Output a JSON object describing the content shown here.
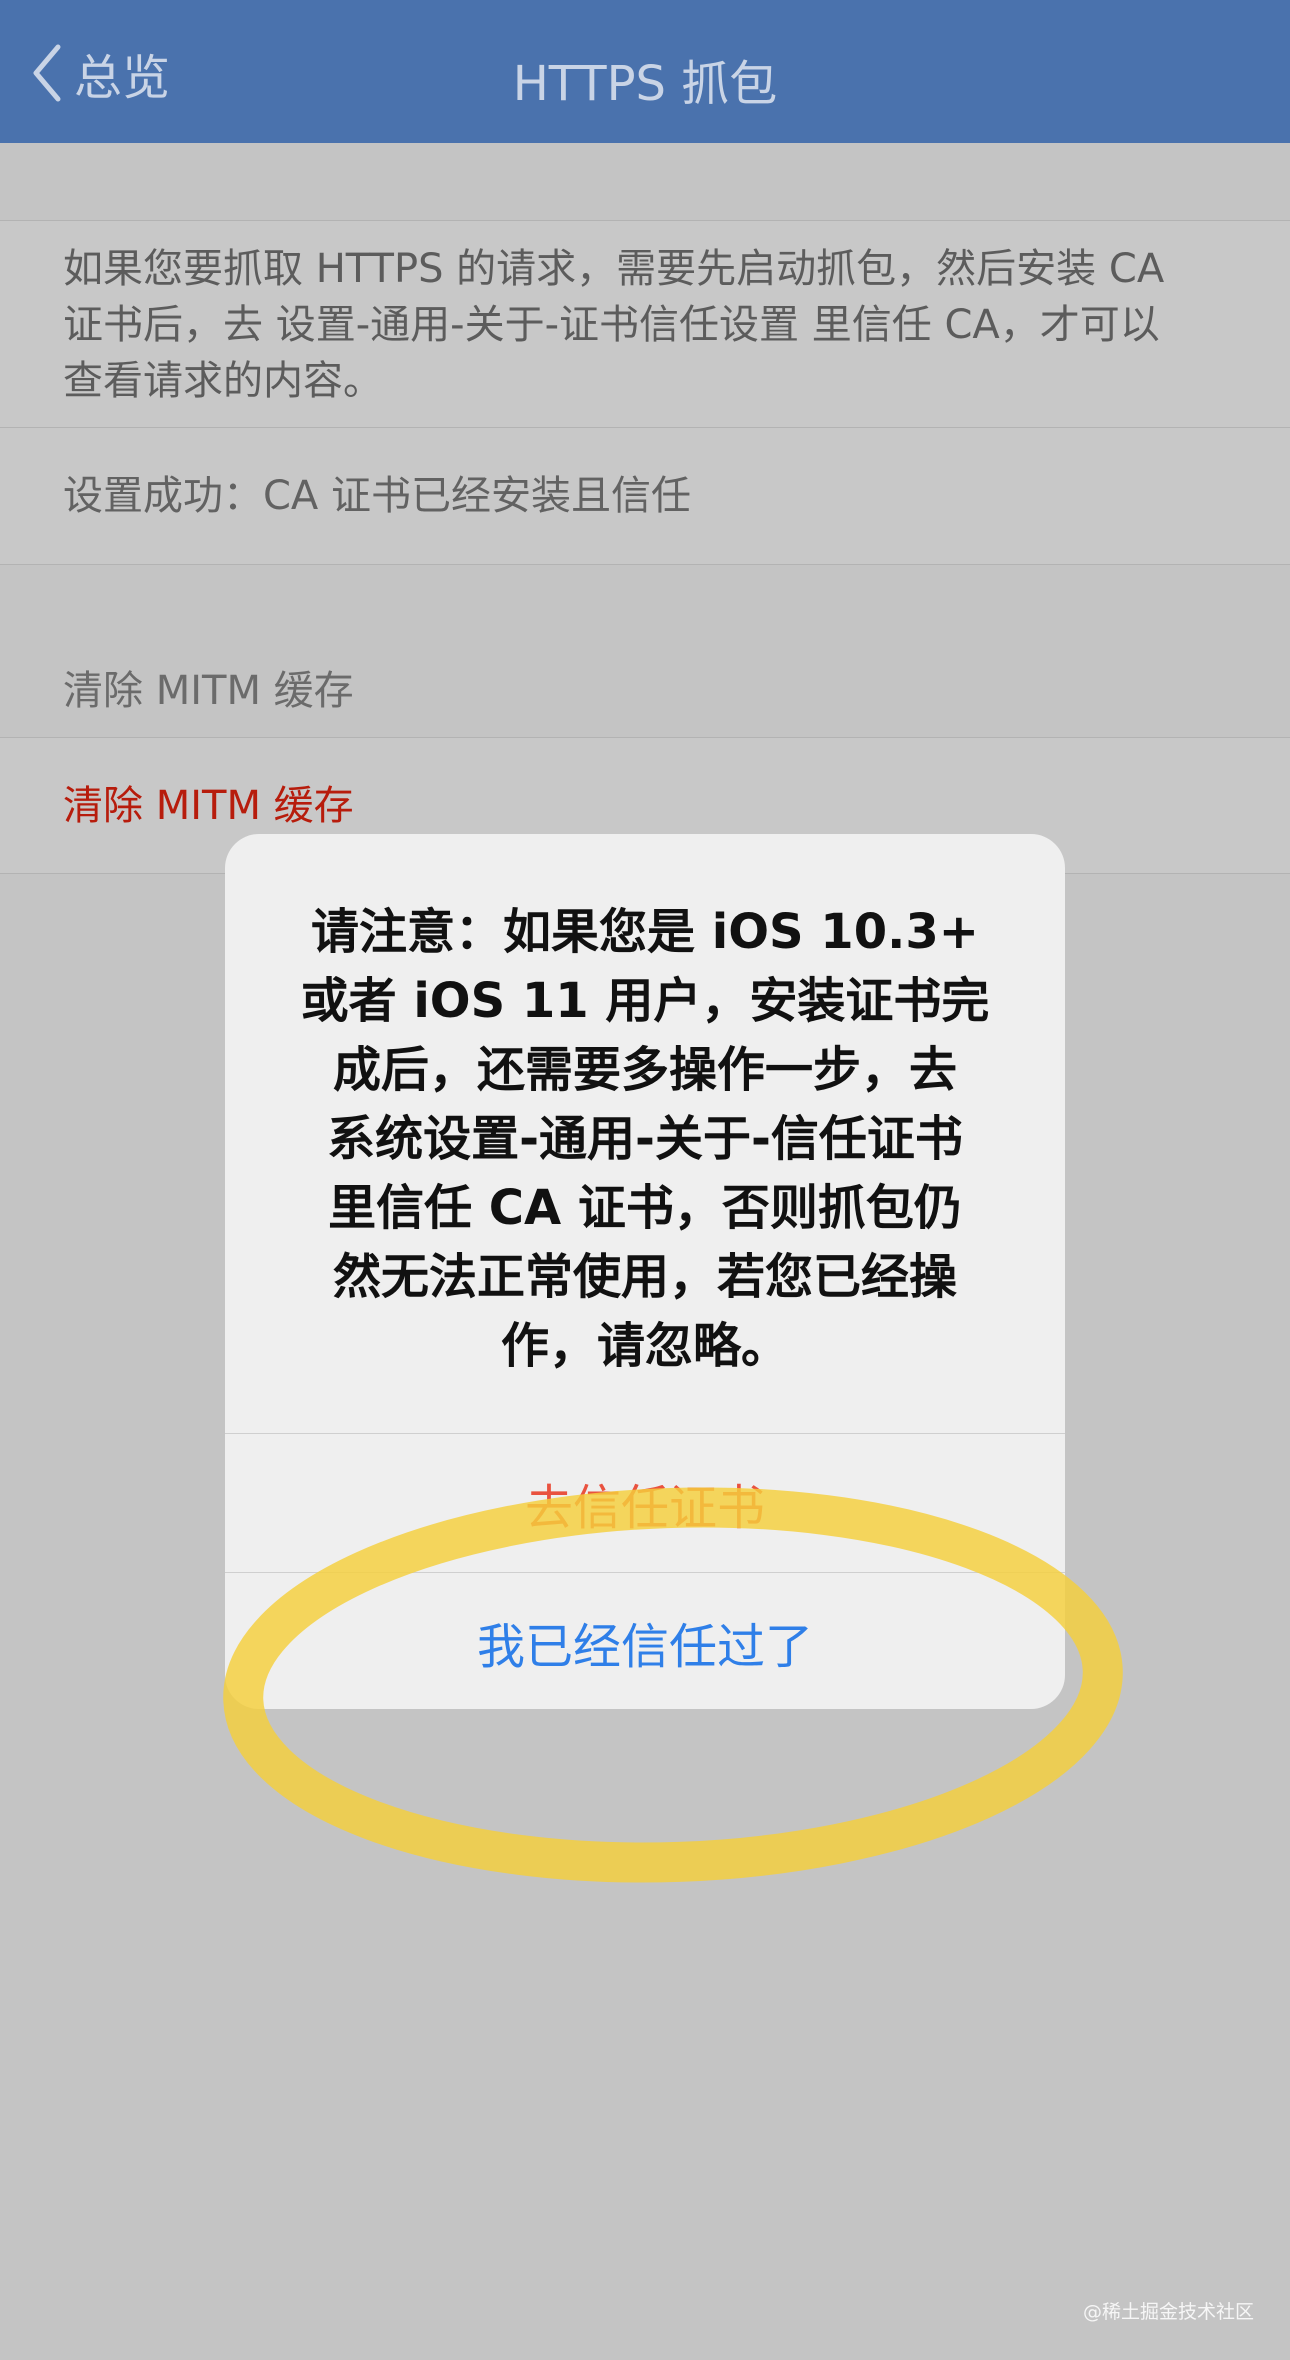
{
  "navbar": {
    "back_label": "总览",
    "title": "HTTPS 抓包"
  },
  "description": {
    "lines": [
      "如果您要抓取 HTTPS 的请求，需要先启动抓包，然后安装 CA",
      "证书后，去 设置-通用-关于-证书信任设置 里信任 CA，才可以",
      "查看请求的内容。"
    ]
  },
  "status": {
    "text": "设置成功：CA 证书已经安装且信任"
  },
  "mitm_section": {
    "header": "清除 MITM 缓存",
    "action_label": "清除 MITM 缓存"
  },
  "alert": {
    "message_lines": [
      "请注意：如果您是 iOS 10.3+",
      "或者  iOS 11 用户，安装证书完",
      "成后，还需要多操作一步，去",
      "系统设置-通用-关于-信任证书",
      "里信任 CA 证书，否则抓包仍",
      "然无法正常使用，若您已经操",
      "作，请忽略。"
    ],
    "buttons": {
      "trust_certificate": "去信任证书",
      "already_trusted": "我已经信任过了"
    }
  },
  "watermark": "@稀土掘金技术社区",
  "colors": {
    "navbar": "#4a72ad",
    "destructive": "#b71c0c",
    "alert_primary": "#e9523f",
    "alert_action": "#2f7fe8",
    "highlight": "#f5cf3c"
  },
  "icons": {
    "back": "chevron-left-icon"
  }
}
